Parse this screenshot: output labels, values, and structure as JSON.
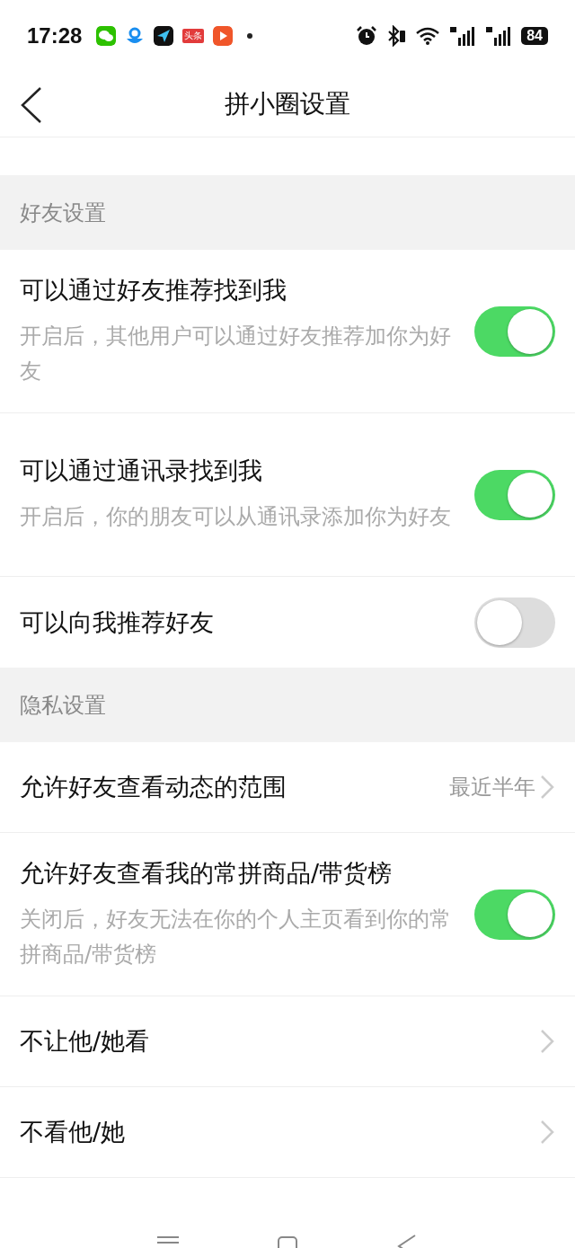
{
  "status_bar": {
    "time": "17:28",
    "news_app_label": "头条",
    "battery": "84"
  },
  "header": {
    "title": "拼小圈设置"
  },
  "sections": [
    {
      "title": "好友设置",
      "rows": [
        {
          "kind": "toggle",
          "label": "可以通过好友推荐找到我",
          "description": "开启后，其他用户可以通过好友推荐加你为好友",
          "on": true
        },
        {
          "kind": "toggle",
          "label": "可以通过通讯录找到我",
          "description": "开启后，你的朋友可以从通讯录添加你为好友",
          "on": true
        },
        {
          "kind": "toggle",
          "label": "可以向我推荐好友",
          "on": false
        }
      ]
    },
    {
      "title": "隐私设置",
      "rows": [
        {
          "kind": "link",
          "label": "允许好友查看动态的范围",
          "value": "最近半年"
        },
        {
          "kind": "toggle",
          "label": "允许好友查看我的常拼商品/带货榜",
          "description": "关闭后，好友无法在你的个人主页看到你的常拼商品/带货榜",
          "on": true
        },
        {
          "kind": "link",
          "label": "不让他/她看"
        },
        {
          "kind": "link",
          "label": "不看他/她"
        }
      ]
    }
  ]
}
